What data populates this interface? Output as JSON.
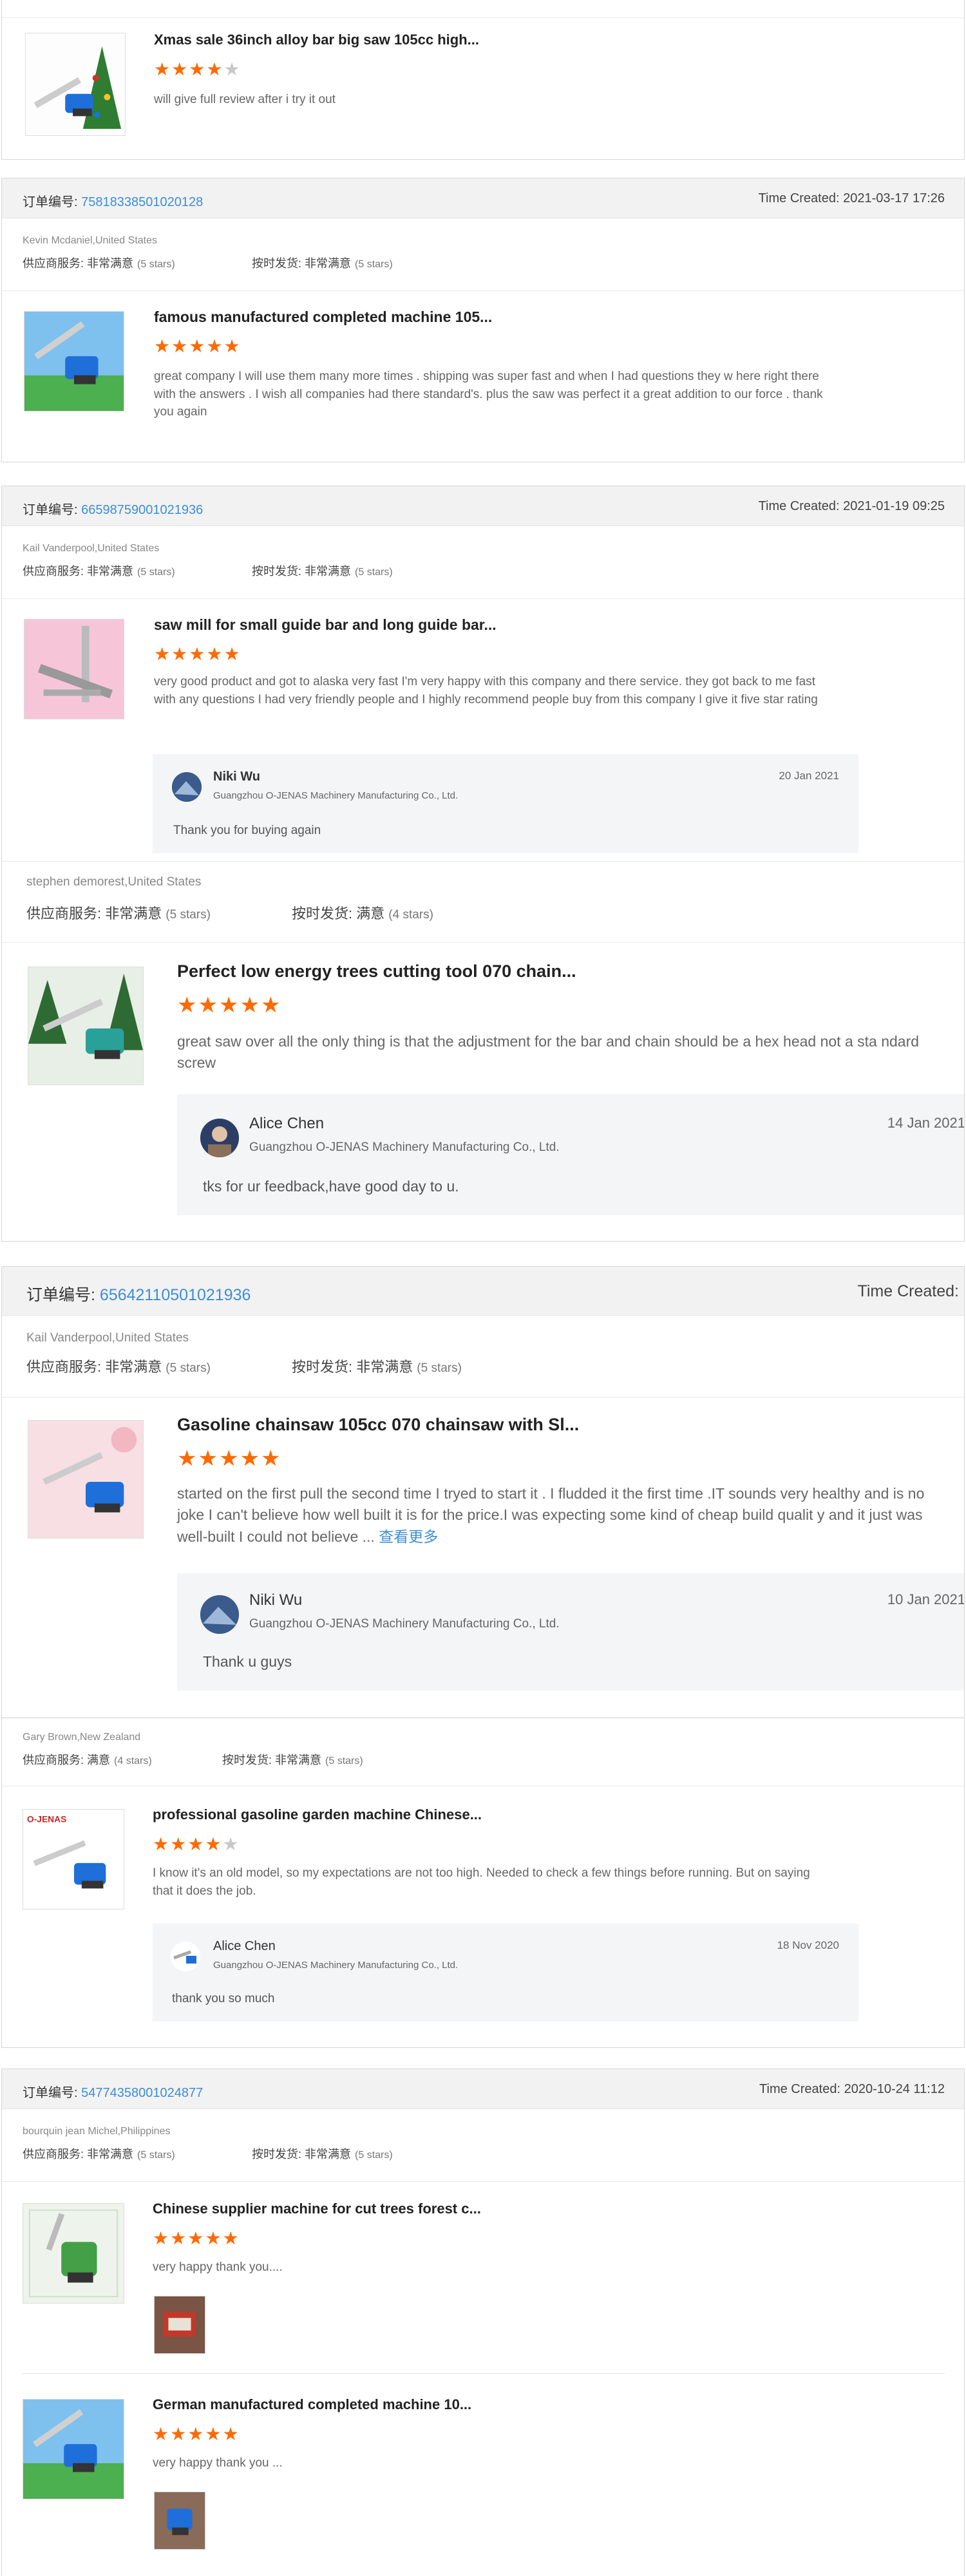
{
  "star_color": "#ff6a00",
  "link_color": "#3d8ed6",
  "common": {
    "order_label": "订单编号:",
    "supplier_service_label": "供应商服务:",
    "on_time_label": "按时发货:",
    "very_satisfied": "非常满意",
    "satisfied": "满意",
    "five_stars": "(5 stars)",
    "four_stars": "(4 stars)",
    "time_created_label": "Time Created:",
    "see_more": "查看更多"
  },
  "review1": {
    "title": "Xmas sale 36inch alloy bar big saw 105cc high...",
    "rating": 4,
    "text": "will give full review after i try it out"
  },
  "order1": {
    "number": "75818338501020128",
    "time": "Time Created: 2021-03-17 17:26",
    "buyer": "Kevin Mcdaniel,United States",
    "title": "famous manufactured completed machine 105...",
    "rating": 5,
    "text": "great company I will use them many more times . shipping was super fast and when I had questions they w here right there with the answers . I wish all companies had there standard's. plus the saw was perfect it a great addition to our force . thank you again"
  },
  "order2": {
    "number": "66598759001021936",
    "time": "Time Created: 2021-01-19 09:25",
    "buyer": "Kail Vanderpool,United States",
    "title": "saw mill for small guide bar and long guide bar...",
    "rating": 5,
    "text": "very good product and got to alaska very fast I'm very happy with this company and there service.  they got back to me fast with any questions I had very friendly people and I highly recommend people buy from this company I give it five star rating",
    "reply": {
      "name": "Niki Wu",
      "company": "Guangzhou O-JENAS Machinery Manufacturing Co., Ltd.",
      "date": "20 Jan 2021",
      "text": "Thank you for buying again"
    }
  },
  "review3": {
    "buyer": "stephen demorest,United States",
    "title": "Perfect low energy trees cutting tool 070 chain...",
    "rating": 5,
    "text": "great saw over all the only thing is that the adjustment for the bar and chain should be a hex head not a sta ndard screw",
    "reply": {
      "name": "Alice Chen",
      "company": "Guangzhou O-JENAS Machinery Manufacturing Co., Ltd.",
      "date": "14 Jan 2021",
      "text": "tks for ur feedback,have good day to u."
    }
  },
  "order4": {
    "number": "65642110501021936",
    "time": "Time Created:",
    "buyer": "Kail Vanderpool,United States",
    "title": "Gasoline chainsaw 105cc 070 chainsaw with Sl...",
    "rating": 5,
    "text": "started on the first pull the second time I tryed to start it  . I fludded it the first time .IT sounds very healthy and is no joke I can't believe how well built it is for the price.I was expecting some kind of cheap build qualit y and it just was well-built I could not believe ...",
    "reply": {
      "name": "Niki Wu",
      "company": "Guangzhou O-JENAS Machinery Manufacturing Co., Ltd.",
      "date": "10 Jan 2021",
      "text": "Thank u guys"
    }
  },
  "review5": {
    "buyer": "Gary Brown,New Zealand",
    "title": "professional gasoline garden machine Chinese...",
    "rating": 4,
    "text": "I know it's an old model, so my expectations are not too high. Needed to check a few things before running. But on saying that it does the job.",
    "logo_text": "O-JENAS",
    "reply": {
      "name": "Alice Chen",
      "company": "Guangzhou O-JENAS Machinery Manufacturing Co., Ltd.",
      "date": "18 Nov 2020",
      "text": "thank you so much"
    }
  },
  "order6": {
    "number": "54774358001024877",
    "time": "Time Created: 2020-10-24 11:12",
    "buyer": "bourquin jean Michel,Philippines",
    "item1": {
      "title": "Chinese supplier machine for cut trees forest c...",
      "rating": 5,
      "text": "very happy thank you...."
    },
    "item2": {
      "title": "German manufactured completed machine 10...",
      "rating": 5,
      "text": "very happy thank you ..."
    }
  }
}
